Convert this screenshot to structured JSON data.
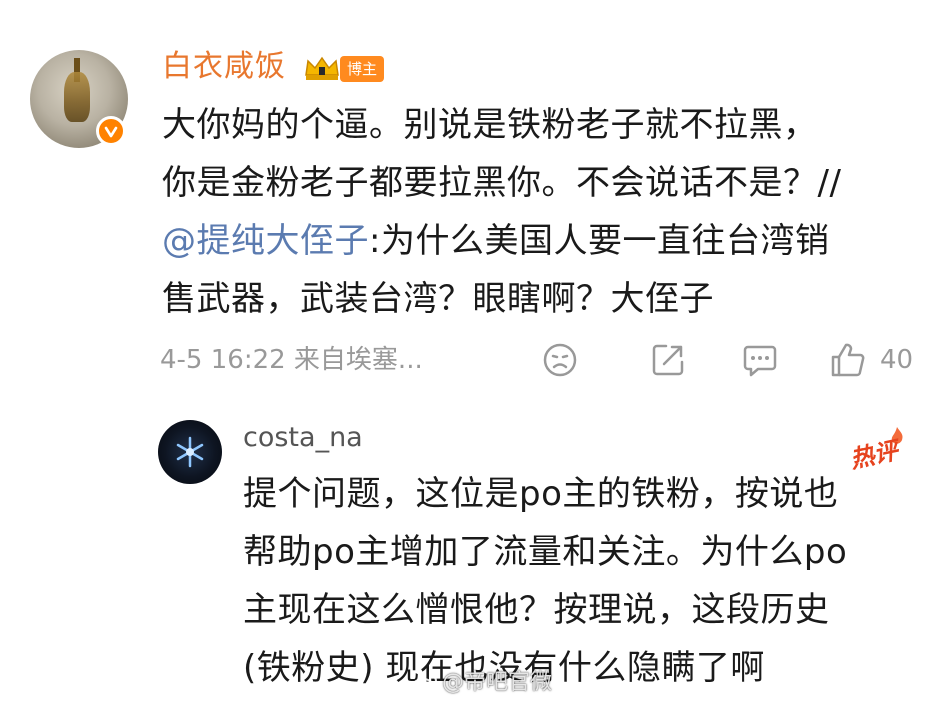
{
  "post": {
    "username": "白衣咸饭",
    "badge": "博主",
    "lines": [
      "大你妈的个逼。别说是铁粉老子就不拉黑，",
      "你是金粉老子都要拉黑你。不会说话不是？//"
    ],
    "mention": "@提纯大侄子",
    "mention_rest": ":为什么美国人要一直往台湾销",
    "last_line": "售武器，武装台湾？眼瞎啊？大侄子",
    "meta": "4-5 16:22  来自埃塞...",
    "like_count": "40"
  },
  "reply": {
    "username": "costa_na",
    "hot_label": "热评",
    "lines": [
      "提个问题，这位是po主的铁粉，按说也",
      "帮助po主增加了流量和关注。为什么po",
      "主现在这么憎恨他？按理说，这段历史",
      "(铁粉史) 现在也没有什么隐瞒了啊"
    ]
  },
  "watermark": "@帝吧官微",
  "colors": {
    "username": "#e8772e",
    "badge_bg": "#ff8a1f",
    "verify": "#ff8200",
    "mention": "#5b7bb0",
    "meta": "#999999",
    "hot": "#e6431e"
  },
  "icons": [
    "verified-badge-icon",
    "crown-level-icon",
    "sad-face-icon",
    "share-icon",
    "comment-icon",
    "thumbs-up-icon",
    "snowflake-avatar-icon",
    "weibo-logo-icon"
  ]
}
